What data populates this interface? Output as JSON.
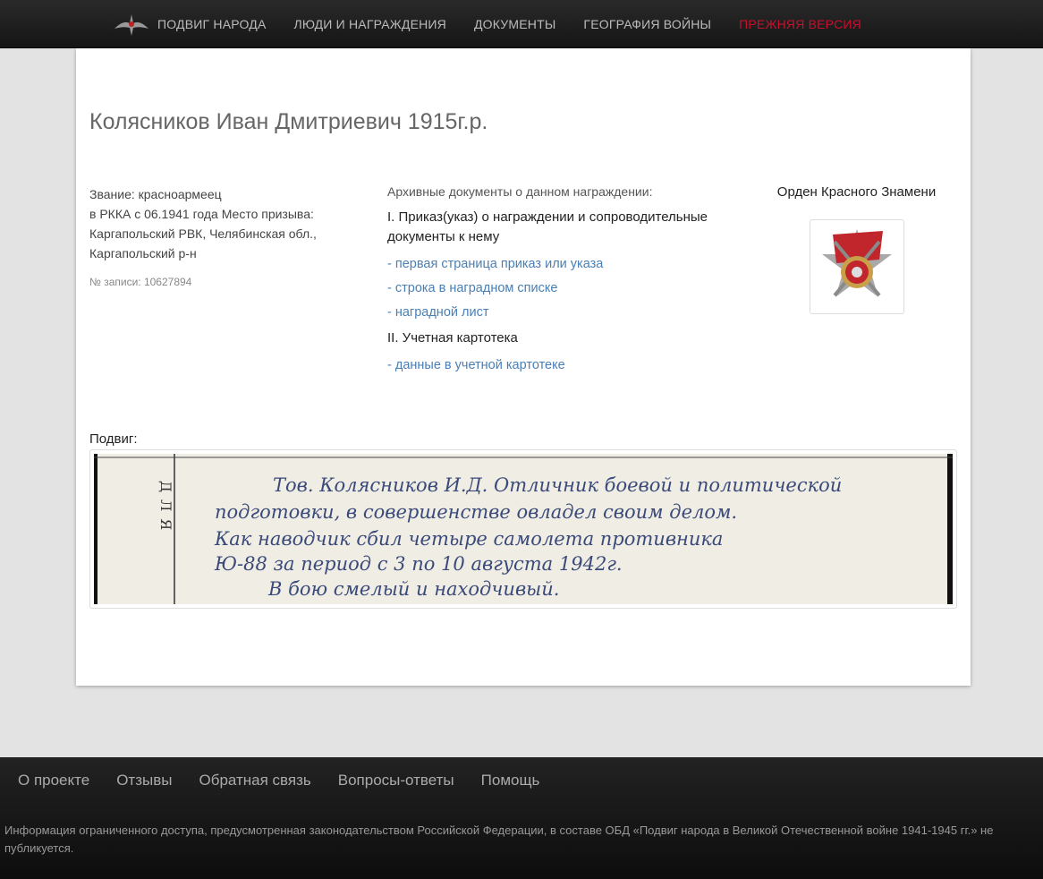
{
  "nav": {
    "items": [
      "ПОДВИГ НАРОДА",
      "ЛЮДИ И НАГРАЖДЕНИЯ",
      "ДОКУМЕНТЫ",
      "ГЕОГРАФИЯ ВОЙНЫ",
      "ПРЕЖНЯЯ ВЕРСИЯ"
    ]
  },
  "person": {
    "title": "Колясников Иван Дмитриевич 1915г.р.",
    "rank": "Звание: красноармеец",
    "details": "в РККА с 06.1941 года Место призыва: Каргапольский РВК, Челябинская обл., Каргапольский р-н",
    "record": "№ записи: 10627894"
  },
  "archive": {
    "heading": "Архивные документы о данном награждении:",
    "section1": "I. Приказ(указ) о награждении и сопроводительные документы к нему",
    "links1": [
      "- первая страница приказ или указа",
      "- строка в наградном списке",
      "- наградной лист"
    ],
    "section2": "II. Учетная картотека",
    "links2": [
      "- данные в учетной картотеке"
    ]
  },
  "award": {
    "name": "Орден Красного Знамени"
  },
  "feat": {
    "label": "Подвиг:",
    "handwriting": [
      "Тов. Колясников И.Д. Отличник боевой и политической",
      "подготовки, в совершенстве овладел своим делом.",
      "Как наводчик сбил четыре самолета противника",
      "Ю-88 за период с 3 по 10 августа 1942г.",
      "В бою смелый и находчивый."
    ],
    "side": "ДЛЯ"
  },
  "footer": {
    "links": [
      "О проекте",
      "Отзывы",
      "Обратная связь",
      "Вопросы-ответы",
      "Помощь"
    ],
    "note": "Информация ограниченного доступа, предусмотренная законодательством Российской Федерации, в составе ОБД «Подвиг народа в Великой Отечественной войне 1941-1945 гг.» не публикуется."
  }
}
